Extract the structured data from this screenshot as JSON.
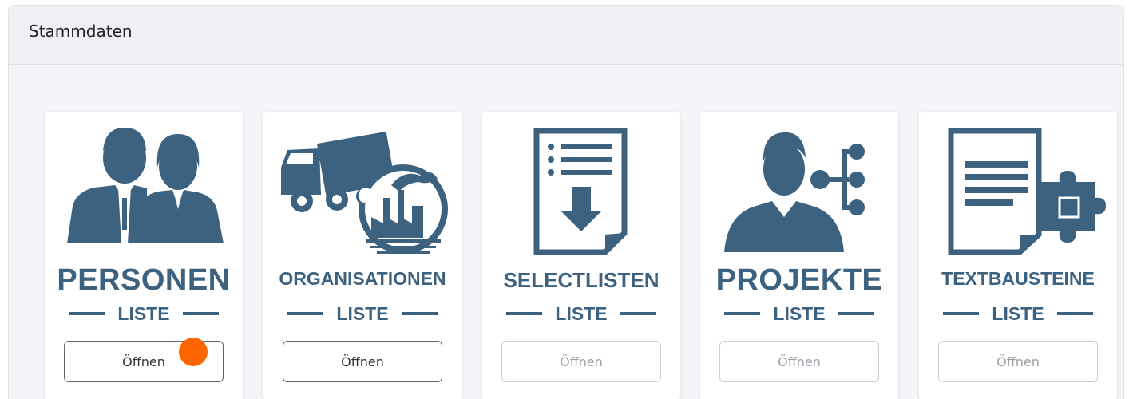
{
  "panel": {
    "title": "Stammdaten"
  },
  "cards": [
    {
      "title": "PERSONEN",
      "subtitle": "LISTE",
      "button": "Öffnen",
      "icon": "people-icon",
      "button_state": "enabled"
    },
    {
      "title": "ORGANISATIONEN",
      "subtitle": "LISTE",
      "button": "Öffnen",
      "icon": "truck-factory-icon",
      "button_state": "enabled"
    },
    {
      "title": "SELECTLISTEN",
      "subtitle": "LISTE",
      "button": "Öffnen",
      "icon": "list-document-icon",
      "button_state": "disabled"
    },
    {
      "title": "PROJEKTE",
      "subtitle": "LISTE",
      "button": "Öffnen",
      "icon": "person-network-icon",
      "button_state": "disabled"
    },
    {
      "title": "TEXTBAUSTEINE",
      "subtitle": "LISTE",
      "button": "Öffnen",
      "icon": "document-puzzle-icon",
      "button_state": "disabled"
    }
  ],
  "colors": {
    "accent": "#3d6280",
    "cursor": "#ff6600"
  }
}
